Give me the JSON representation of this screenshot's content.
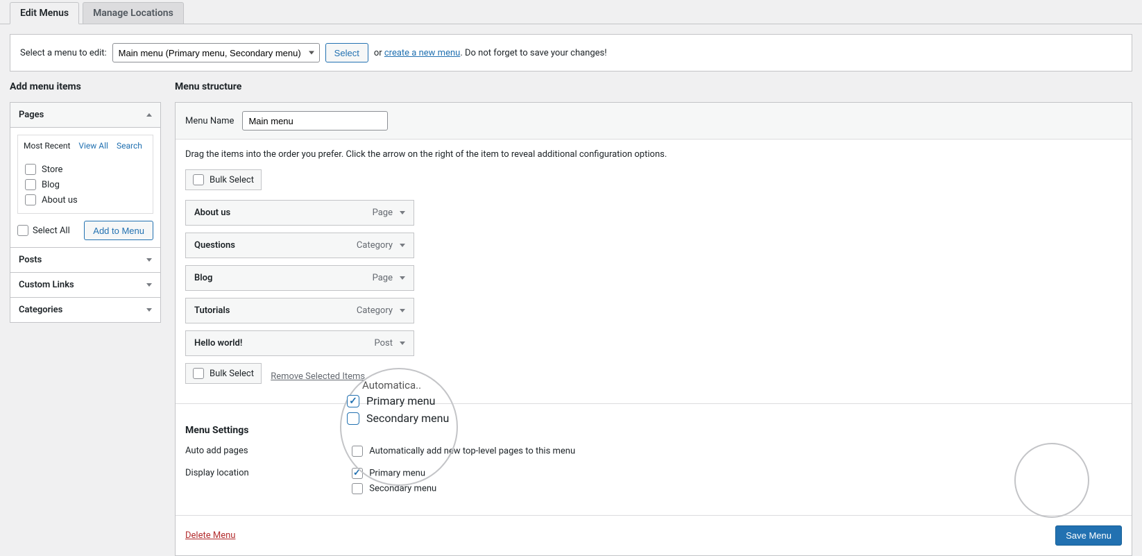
{
  "tabs": {
    "edit": "Edit Menus",
    "locations": "Manage Locations"
  },
  "selectBar": {
    "prompt": "Select a menu to edit:",
    "selected": "Main menu (Primary menu, Secondary menu)",
    "selectBtn": "Select",
    "or": "or",
    "createLink": "create a new menu",
    "reminder": ". Do not forget to save your changes!"
  },
  "leftTitle": "Add menu items",
  "accordion": {
    "pages": {
      "title": "Pages",
      "subtabs": {
        "recent": "Most Recent",
        "viewAll": "View All",
        "search": "Search"
      },
      "items": [
        "Store",
        "Blog",
        "About us"
      ],
      "selectAll": "Select All",
      "addBtn": "Add to Menu"
    },
    "posts": "Posts",
    "customLinks": "Custom Links",
    "categories": "Categories"
  },
  "right": {
    "title": "Menu structure",
    "menuNameLabel": "Menu Name",
    "menuNameValue": "Main menu",
    "instruction": "Drag the items into the order you prefer. Click the arrow on the right of the item to reveal additional configuration options.",
    "bulkSelect": "Bulk Select",
    "removeSelected": "Remove Selected Items",
    "items": [
      {
        "title": "About us",
        "type": "Page"
      },
      {
        "title": "Questions",
        "type": "Category"
      },
      {
        "title": "Blog",
        "type": "Page"
      },
      {
        "title": "Tutorials",
        "type": "Category"
      },
      {
        "title": "Hello world!",
        "type": "Post"
      }
    ],
    "settingsTitle": "Menu Settings",
    "autoAddLabel": "Auto add pages",
    "autoAddOption": "Automatically add new top-level pages to this menu",
    "displayLocLabel": "Display location",
    "locPrimary": "Primary menu",
    "locSecondary": "Secondary menu",
    "delete": "Delete Menu",
    "save": "Save Menu"
  },
  "magnifier": {
    "headerFrag": "Automatica..",
    "primary": "Primary menu",
    "secondary": "Secondary menu"
  }
}
